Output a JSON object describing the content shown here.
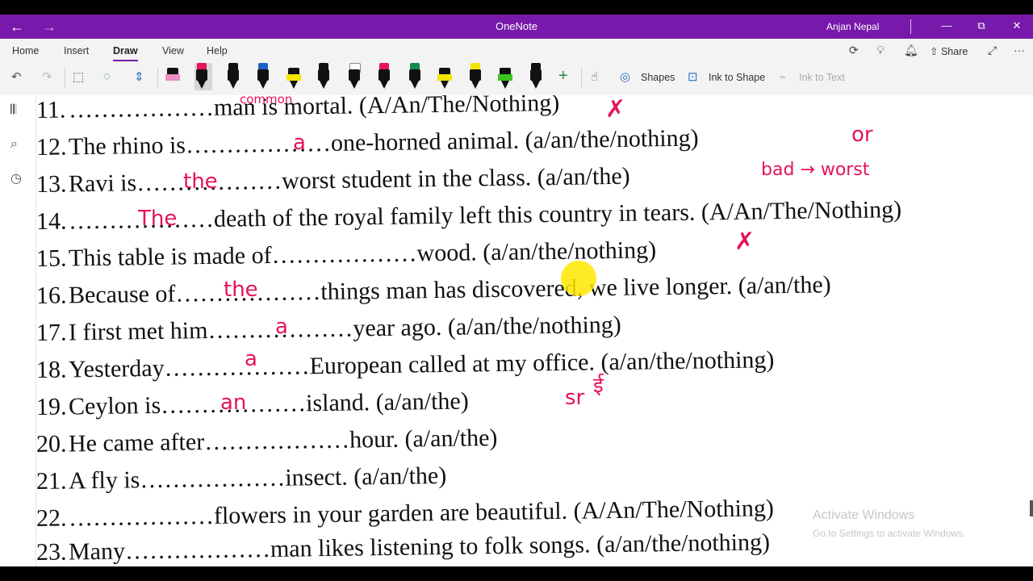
{
  "titlebar": {
    "back_icon": "←",
    "forward_icon": "→",
    "app_title": "OneNote",
    "user_name": "Anjan Nepal",
    "minimize": "—",
    "restore": "⧉",
    "close": "✕"
  },
  "menu": {
    "tabs": [
      "Home",
      "Insert",
      "Draw",
      "View",
      "Help"
    ],
    "active_tab": "Draw",
    "share_label": "Share",
    "more_label": "···"
  },
  "toolbar": {
    "shapes_label": "Shapes",
    "ink_to_shape_label": "Ink to Shape",
    "ink_to_text_label": "Ink to Text",
    "pen_colors": [
      "#111111",
      "#e5135a",
      "#111111",
      "#111111",
      "#1f5fc6",
      "#f2e600",
      "#111111",
      "#111111",
      "#e5135a",
      "#128a4a",
      "#f2e600",
      "#f2e600",
      "#3dc21f",
      "#111111"
    ]
  },
  "exercise": {
    "lines": [
      {
        "num": "11.",
        "text": "………………man is mortal. (A/An/The/Nothing)"
      },
      {
        "num": "12.",
        "text": "The rhino is………………one-horned animal. (a/an/the/nothing)"
      },
      {
        "num": "13.",
        "text": "Ravi is………………worst student in the class. (a/an/the)"
      },
      {
        "num": "14.",
        "text": "………………death of the royal family left this country in tears. (A/An/The/Nothing)"
      },
      {
        "num": "15.",
        "text": "This table is made of………………wood. (a/an/the/nothing)"
      },
      {
        "num": "16.",
        "text": "Because of………………things man has discovered, we live longer. (a/an/the)"
      },
      {
        "num": "17.",
        "text": "I first met him………………year ago. (a/an/the/nothing)"
      },
      {
        "num": "18.",
        "text": "Yesterday………………European called at my office. (a/an/the/nothing)"
      },
      {
        "num": "19.",
        "text": "Ceylon is………………island. (a/an/the)"
      },
      {
        "num": "20.",
        "text": "He came after………………hour. (a/an/the)"
      },
      {
        "num": "21.",
        "text": "A fly is………………insect. (a/an/the)"
      },
      {
        "num": "22.",
        "text": "………………flowers in your garden are beautiful. (A/An/The/Nothing)"
      },
      {
        "num": "23.",
        "text": "Many………………man likes listening to folk songs. (a/an/the/nothing)"
      }
    ],
    "ink": {
      "l11_note": "common",
      "l12_answer": "a",
      "l12_note": "or",
      "l13_answer": "the",
      "l13_note": "bad → worst",
      "l14_answer": "The",
      "l16_answer": "the",
      "l17_answer": "a",
      "l18_answer": "a",
      "l19_answer": "an",
      "l19_note": "sr",
      "l19_note2": "ई"
    }
  },
  "watermark": {
    "title": "Activate Windows",
    "subtitle": "Go to Settings to activate Windows."
  }
}
